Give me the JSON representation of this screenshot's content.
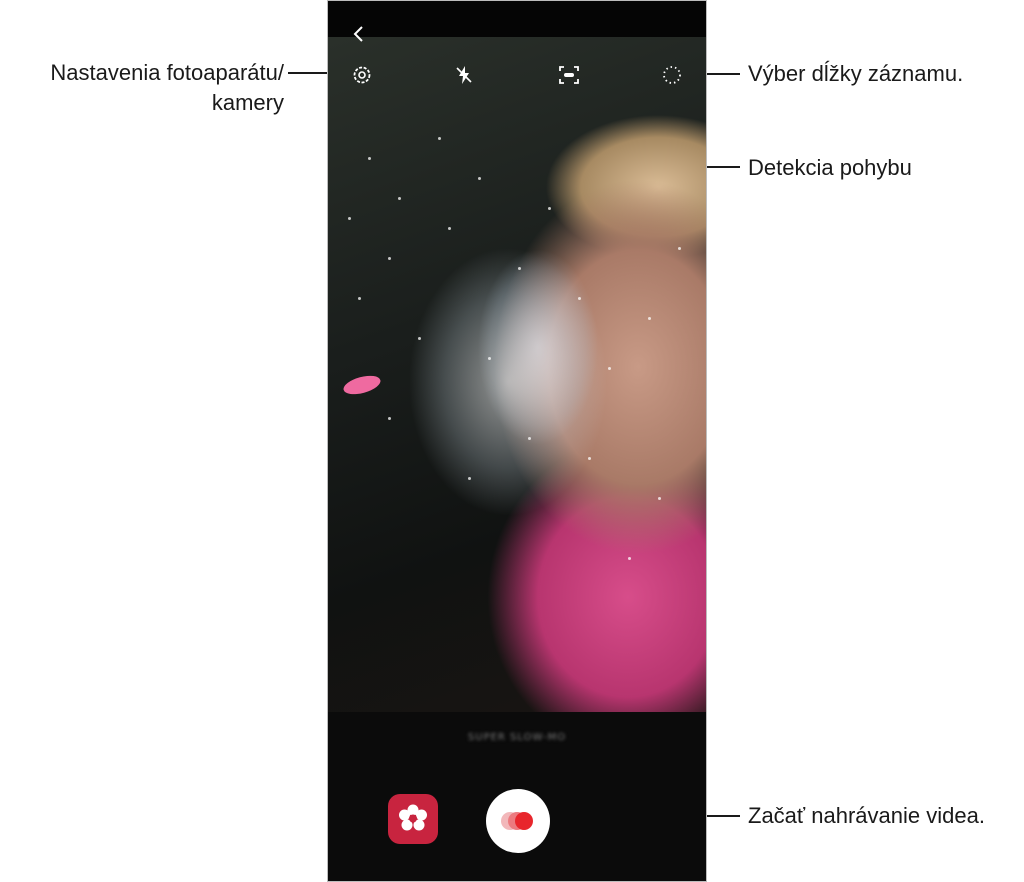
{
  "callouts": {
    "settings_line1": "Nastavenia fotoaparátu/",
    "settings_line2": "kamery",
    "duration": "Výber dĺžky záznamu.",
    "motion": "Detekcia pohybu",
    "record": "Začať nahrávanie videa."
  },
  "camera": {
    "mode": "SUPER SLOW-MO",
    "icons": {
      "back": "back-arrow-icon",
      "settings": "gear-icon",
      "flash": "flash-off-icon",
      "motion": "motion-detection-icon",
      "duration": "recording-duration-icon",
      "gallery": "gallery-flower-icon",
      "record": "record-button-icon"
    },
    "colors": {
      "gallery": "#c8243f",
      "record_dot": "#e8262c"
    }
  }
}
